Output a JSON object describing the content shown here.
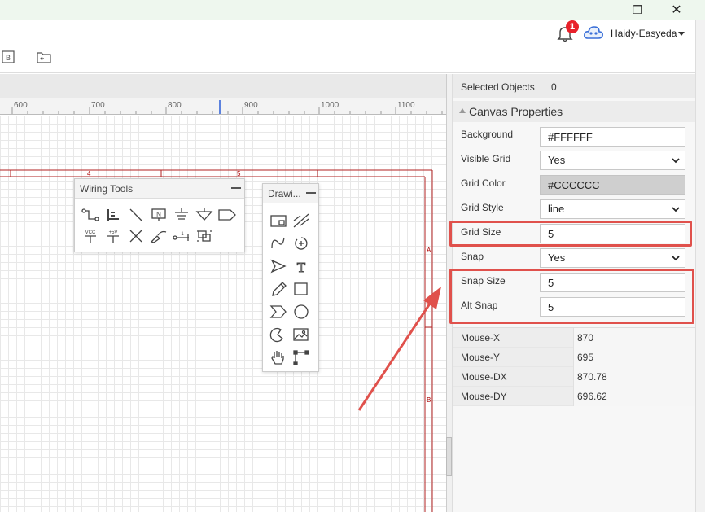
{
  "window": {
    "minimize_glyph": "—",
    "maximize_glyph": "❐",
    "close_glyph": "✕"
  },
  "header": {
    "notification_count": "1",
    "user_name": "Haidy-Easyeda"
  },
  "ruler": {
    "labels": [
      "600",
      "700",
      "800",
      "900",
      "1000",
      "1100"
    ]
  },
  "sheet": {
    "column_labels": [
      "4",
      "5"
    ],
    "row_labels": [
      "A",
      "B"
    ]
  },
  "wiring_tools": {
    "title": "Wiring Tools",
    "tools": [
      "wire-tool-icon",
      "bus-tool-icon",
      "bus-entry-icon",
      "net-label-icon",
      "ground-icon",
      "gnd-arrow-icon",
      "net-port-icon",
      "vcc-icon",
      "plus5v-icon",
      "no-connect-icon",
      "voltage-probe-icon",
      "pin-icon",
      "group-icon"
    ],
    "labels": {
      "net": "N",
      "vcc": "VCC",
      "plus5v": "+5V",
      "pin": "1"
    }
  },
  "drawing_tools": {
    "title": "Drawi...",
    "tools": [
      "bounding-box-icon",
      "line-icon",
      "bezier-icon",
      "arc-icon",
      "polyline-arrow-icon",
      "text-icon",
      "freehand-icon",
      "rectangle-icon",
      "polygon-icon",
      "circle-icon",
      "pie-icon",
      "image-icon",
      "pan-icon",
      "drag-icon"
    ],
    "text_glyph": "T"
  },
  "panel": {
    "selected_label": "Selected Objects",
    "selected_value": "0",
    "section_title": "Canvas Properties",
    "background_label": "Background",
    "background_value": "#FFFFFF",
    "visible_grid_label": "Visible Grid",
    "visible_grid_value": "Yes",
    "grid_color_label": "Grid Color",
    "grid_color_value": "#CCCCCC",
    "grid_style_label": "Grid Style",
    "grid_style_value": "line",
    "grid_size_label": "Grid Size",
    "grid_size_value": "5",
    "snap_label": "Snap",
    "snap_value": "Yes",
    "snap_size_label": "Snap Size",
    "snap_size_value": "5",
    "alt_snap_label": "Alt Snap",
    "alt_snap_value": "5",
    "mouse": [
      {
        "key": "Mouse-X",
        "value": "870"
      },
      {
        "key": "Mouse-Y",
        "value": "695"
      },
      {
        "key": "Mouse-DX",
        "value": "870.78"
      },
      {
        "key": "Mouse-DY",
        "value": "696.62"
      }
    ]
  },
  "colors": {
    "highlight": "#e0514c",
    "badge": "#e8212b",
    "frame": "#b22222",
    "grid_line": "#e8e8e8"
  }
}
